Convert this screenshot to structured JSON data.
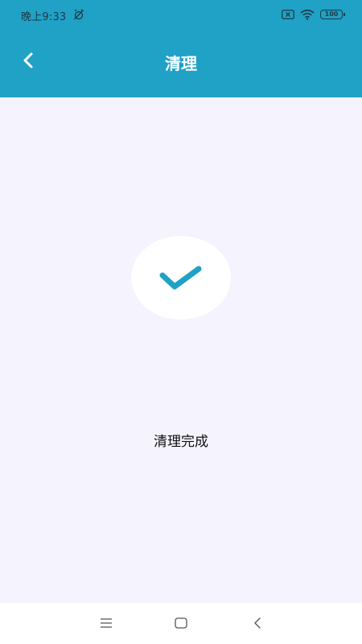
{
  "status_bar": {
    "time": "晚上9:33",
    "battery": "100"
  },
  "header": {
    "title": "清理",
    "back_icon": "chevron-left-icon",
    "background_color": "#20a1c6"
  },
  "main": {
    "status_icon": "checkmark-icon",
    "status_text": "清理完成",
    "accent_color": "#20a1c6",
    "background_color": "#f4f3fe"
  },
  "nav_bar": {
    "icons": [
      "menu-icon",
      "home-icon",
      "back-icon"
    ]
  }
}
